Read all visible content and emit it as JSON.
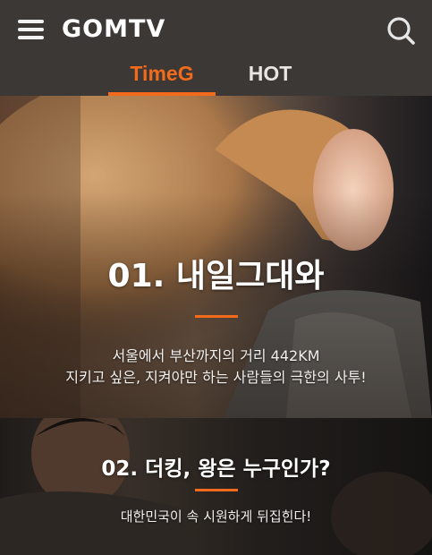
{
  "header": {
    "logo": "GOMTV",
    "menu_icon": "hamburger-menu-icon",
    "search_icon": "search-icon",
    "tabs": [
      {
        "label": "TimeG",
        "active": true
      },
      {
        "label": "HOT",
        "active": false
      }
    ],
    "accent_color": "#f26a1b",
    "background_color": "#3c3836"
  },
  "cards": [
    {
      "title": "01. 내일그대와",
      "desc_line1": "서울에서 부산까지의 거리 442KM",
      "desc_line2": "지키고 싶은, 지켜야만 하는 사람들의 극한의 사투!"
    },
    {
      "title": "02. 더킹, 왕은 누구인가?",
      "desc_line1": "대한민국이 속 시원하게 뒤집힌다!"
    }
  ]
}
